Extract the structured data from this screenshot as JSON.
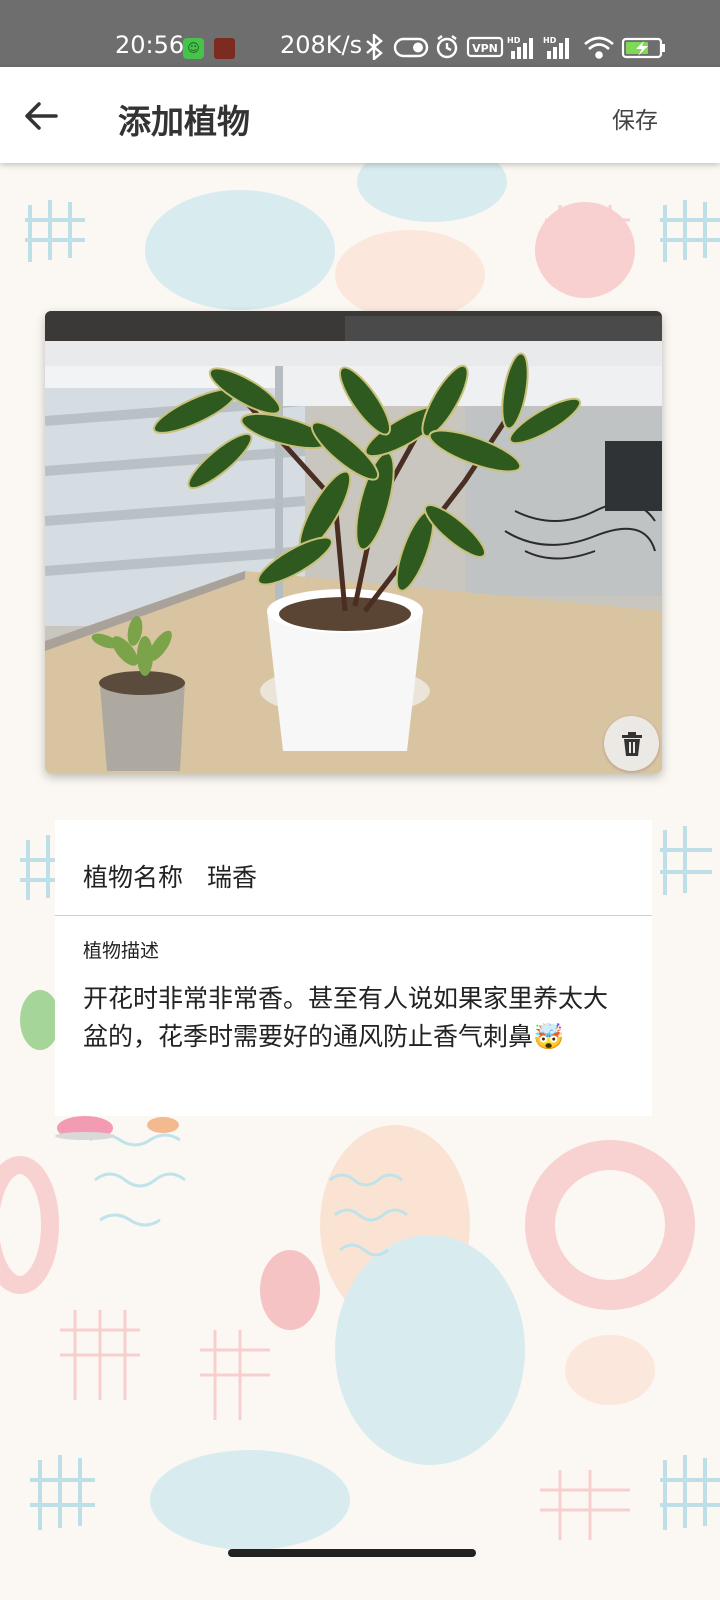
{
  "status_bar": {
    "time": "20:56",
    "network_speed": "208K/s",
    "icons": [
      "wechat-app-icon",
      "app-icon",
      "bluetooth-icon",
      "toggle-icon",
      "alarm-icon",
      "vpn-icon",
      "signal-hd-icon",
      "signal-hd-icon",
      "wifi-icon",
      "battery-charging-icon"
    ],
    "vpn_label": "VPN",
    "hd_label": "HD"
  },
  "toolbar": {
    "title": "添加植物",
    "save_label": "保存",
    "back_icon": "arrow-left-icon"
  },
  "photo": {
    "subject": "potted plant on desk",
    "delete_icon": "trash-icon"
  },
  "form": {
    "name_label": "植物名称",
    "name_value": "瑞香",
    "description_label": "植物描述",
    "description_value": "开花时非常非常香。甚至有人说如果家里养太大盆的，花季时需要好的通风防止香气刺鼻🤯"
  },
  "colors": {
    "status_bar_bg": "#6e6e6e",
    "toolbar_bg": "#ffffff",
    "page_bg": "#fbf7f2",
    "text": "#222222"
  }
}
